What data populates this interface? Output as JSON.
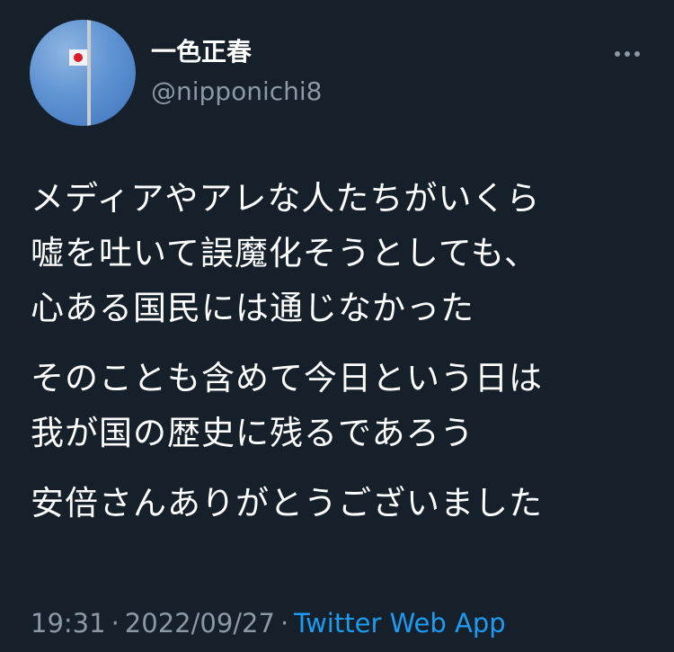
{
  "user": {
    "display_name": "一色正春",
    "handle": "@nipponichi8"
  },
  "more_icon": "more-horizontal-icon",
  "tweet": {
    "paragraphs": [
      [
        "メディアやアレな人たちがいくら",
        "嘘を吐いて誤魔化そうとしても、",
        "心ある国民には通じなかった"
      ],
      [
        "そのことも含めて今日という日は",
        "我が国の歴史に残るであろう"
      ],
      [
        "安倍さんありがとうございました"
      ]
    ]
  },
  "meta": {
    "time": "19:31",
    "separator": "·",
    "date": "2022/09/27",
    "source": "Twitter Web App"
  },
  "colors": {
    "background": "#15202b",
    "text": "#ffffff",
    "secondary": "#8b98a5",
    "link": "#1d9bf0"
  }
}
